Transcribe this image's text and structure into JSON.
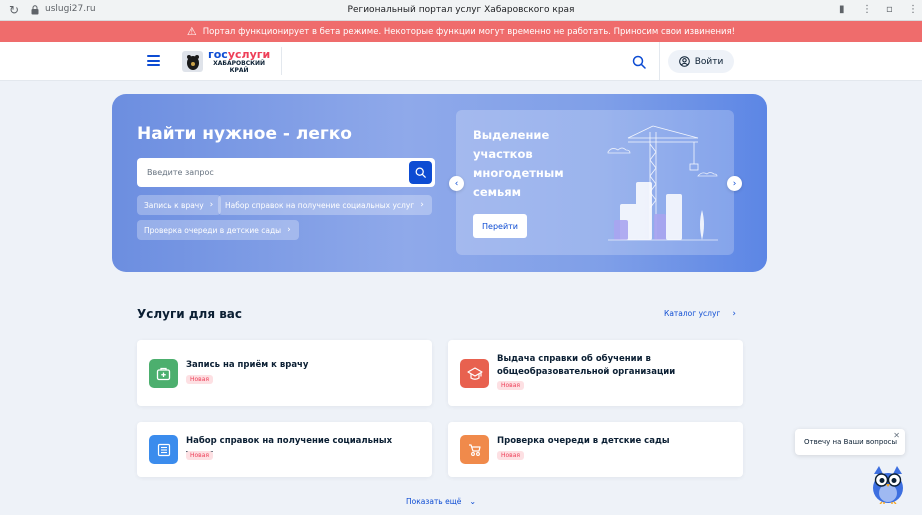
{
  "browser": {
    "url": "uslugi27.ru",
    "tab_title": "Региональный портал услуг Хабаровского края"
  },
  "banner": {
    "text": "Портал функционирует в бета режиме. Некоторые функции могут временно не работать. Приносим свои извинения!",
    "color": "#ef6c6c"
  },
  "header": {
    "logo_gos": "гос",
    "logo_uslugi": "услуги",
    "logo_region_line1": "ХАБАРОВСКИЙ",
    "logo_region_line2": "КРАЙ",
    "login_label": "Войти"
  },
  "hero": {
    "title": "Найти нужное - легко",
    "search_placeholder": "Введите запрос",
    "chips": [
      "Запись к врачу",
      "Набор справок на получение социальных услуг",
      "Проверка очереди в детские сады"
    ],
    "promo_title": "Выделение участков многодетным семьям",
    "promo_button": "Перейти"
  },
  "services": {
    "title": "Услуги для вас",
    "catalog_link": "Каталог услуг",
    "cards": [
      {
        "title": "Запись на приём к врачу",
        "badge": "Новая",
        "icon": "medical-kit-icon",
        "color": "#4caf6e"
      },
      {
        "title": "Выдача справки об обучении в общеобразовательной организации",
        "badge": "Новая",
        "icon": "graduation-cap-icon",
        "color": "#e8614f"
      },
      {
        "title": "Набор справок на получение социальных услуг",
        "badge": "Новая",
        "icon": "document-list-icon",
        "color": "#3b8ced"
      },
      {
        "title": "Проверка очереди в детские сады",
        "badge": "Новая",
        "icon": "stroller-icon",
        "color": "#f08a4b"
      }
    ],
    "show_more": "Показать ещё"
  },
  "chat": {
    "bubble_text": "Отвечу на Ваши вопросы"
  },
  "colors": {
    "accent": "#0d4cd3",
    "brand_red": "#ee3f58",
    "page_bg": "#eef2f8"
  }
}
